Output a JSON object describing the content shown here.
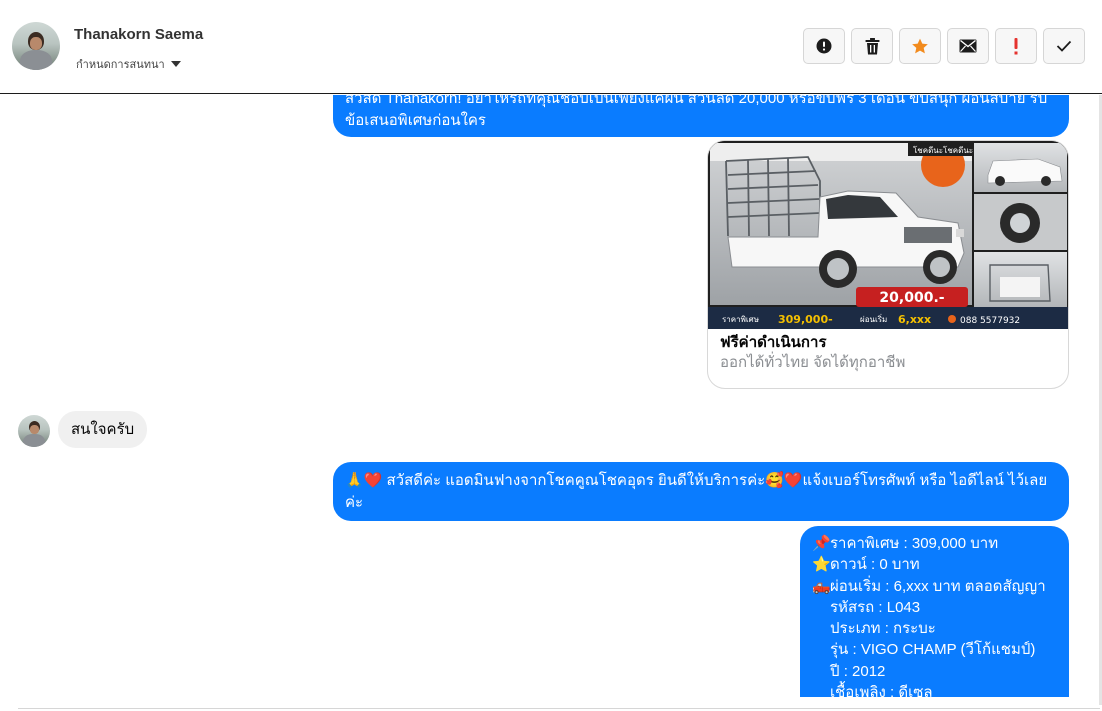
{
  "contact": {
    "name": "Thanakorn Saema",
    "subtitle": "กำหนดการสนทนา"
  },
  "toolbar": {
    "buttons": [
      {
        "name": "report",
        "icon": "alert-circle-icon"
      },
      {
        "name": "delete",
        "icon": "trash-icon"
      },
      {
        "name": "star",
        "icon": "star-icon",
        "color": "#f28b1e"
      },
      {
        "name": "mail",
        "icon": "envelope-icon"
      },
      {
        "name": "important",
        "icon": "exclamation-icon",
        "color": "#e5322e"
      },
      {
        "name": "done",
        "icon": "check-icon"
      }
    ]
  },
  "messages": {
    "m1": {
      "text": "สวัสดี Thanakorn! อย่าให้รถที่คุณชอบเป็นเพียงแค่ฝัน ส่วนลด 20,000 หรือขับฟรี 3 เดือน ขับสนุก ผ่อนสบาย รับข้อเสนอพิเศษก่อนใคร"
    },
    "card": {
      "image_texts": {
        "badge": "โชคดีนะโชคดีนะ",
        "price_tag": "20,000.-",
        "price_label": "ราคาพิเศษ",
        "price": "309,000-",
        "installment_label": "ผ่อนเริ่ม",
        "installment": "6,xxx",
        "phone": "088 5577932"
      },
      "title": "ฟรีค่าดำเนินการ",
      "subtitle": "ออกได้ทั่วไทย จัดได้ทุกอาชีพ"
    },
    "incoming": {
      "text": "สนใจครับ"
    },
    "m3": {
      "text": "🙏❤️ สวัสดีค่ะ แอดมินฟางจากโชคคูณโชคอุดร ยินดีให้บริการค่ะ🥰❤️แจ้งเบอร์โทรศัพท์ หรือ ไอดีไลน์  ไว้เลยค่ะ"
    },
    "m4": {
      "lines": [
        {
          "icon": "📌",
          "text": "ราคาพิเศษ : 309,000 บาท"
        },
        {
          "icon": "⭐",
          "text": "ดาวน์ : 0 บาท"
        },
        {
          "icon": "🛻",
          "text": "ผ่อนเริ่ม : 6,xxx บาท ตลอดสัญญา"
        },
        {
          "icon": "",
          "text": "รหัสรถ : L043"
        },
        {
          "icon": "",
          "text": "ประเภท : กระบะ"
        },
        {
          "icon": "",
          "text": "รุ่น : VIGO CHAMP (วีโก้แชมป์)"
        },
        {
          "icon": "",
          "text": "ปี : 2012"
        },
        {
          "icon": "",
          "text": "เชื้อเพลิง : ดีเซล"
        }
      ]
    }
  },
  "colors": {
    "outgoing_bubble": "#0a7cff",
    "incoming_bubble": "#f0f0f0"
  }
}
